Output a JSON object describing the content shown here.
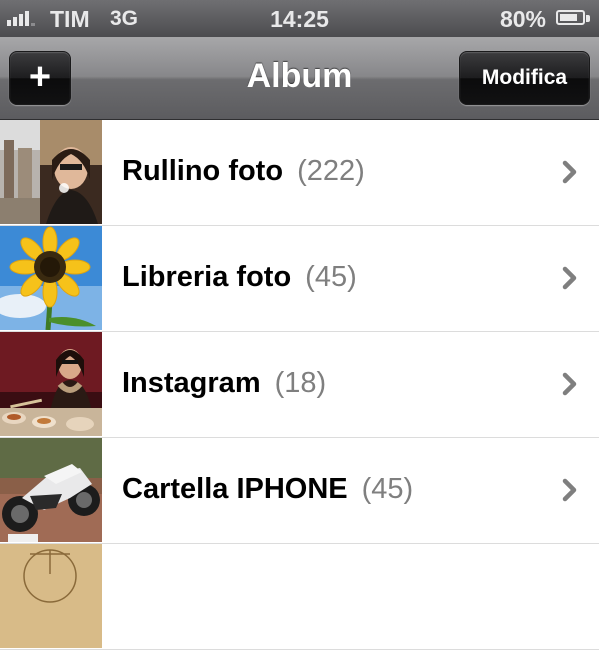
{
  "status_bar": {
    "carrier": "TIM",
    "network": "3G",
    "time": "14:25",
    "battery_text": "80%",
    "battery_level": 0.8,
    "signal_bars": 4
  },
  "nav_bar": {
    "title": "Album",
    "add_label": "+",
    "edit_label": "Modifica"
  },
  "albums": [
    {
      "name": "Rullino foto",
      "count": "(222)",
      "thumb": "street-portrait-photo"
    },
    {
      "name": "Libreria foto",
      "count": "(45)",
      "thumb": "sunflower-photo"
    },
    {
      "name": "Instagram",
      "count": "(18)",
      "thumb": "dinner-table-photo"
    },
    {
      "name": "Cartella IPHONE",
      "count": "(45)",
      "thumb": "motorcycle-photo"
    },
    {
      "name": "",
      "count": "",
      "thumb": "vitruvian-sketch-photo"
    }
  ],
  "colors": {
    "text": "#000000",
    "count": "#7f7f7f",
    "chevron": "#7f7f7f",
    "nav_title": "#ffffff"
  }
}
